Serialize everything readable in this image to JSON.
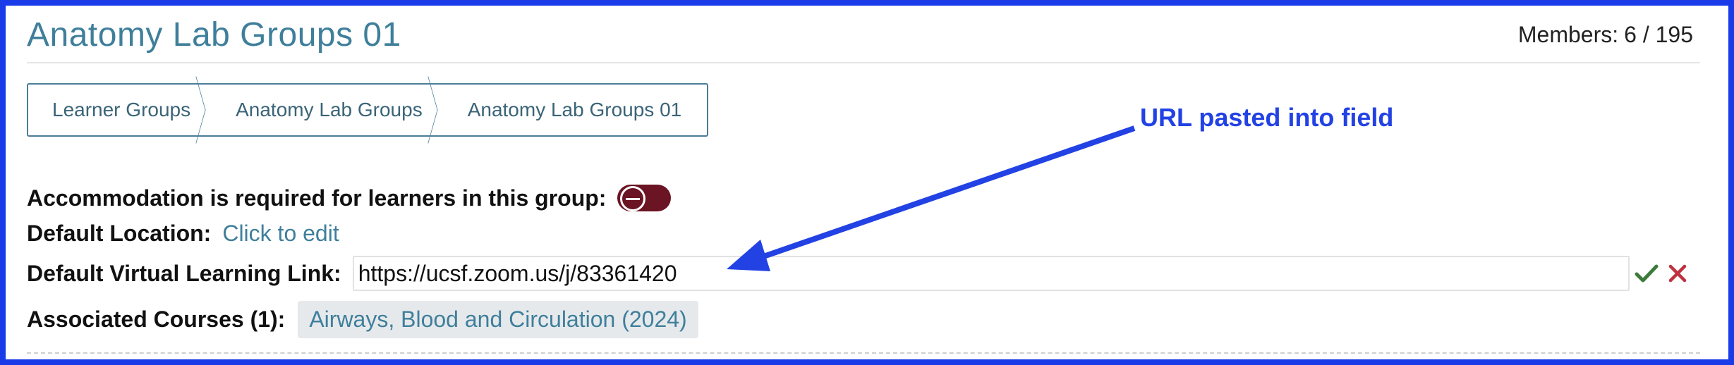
{
  "header": {
    "title": "Anatomy Lab Groups 01",
    "members_label": "Members:",
    "members_value": "6 / 195"
  },
  "breadcrumb": {
    "items": [
      "Learner Groups",
      "Anatomy Lab Groups",
      "Anatomy Lab Groups 01"
    ]
  },
  "accommodation": {
    "label": "Accommodation is required for learners in this group:",
    "toggle_state": "off",
    "toggle_color": "#6b1423"
  },
  "default_location": {
    "label": "Default Location:",
    "value": "Click to edit"
  },
  "virtual_link": {
    "label": "Default Virtual Learning Link:",
    "value": "https://ucsf.zoom.us/j/83361420",
    "save_icon": "checkmark-icon",
    "cancel_icon": "x-icon"
  },
  "courses": {
    "label": "Associated Courses (1):",
    "items": [
      "Airways, Blood and Circulation (2024)"
    ]
  },
  "annotation": {
    "text": "URL pasted into field",
    "color": "#2342e4"
  },
  "colors": {
    "accent": "#3f7f9b",
    "frame": "#1a3be8",
    "success": "#3c7a3a",
    "danger": "#c0313e"
  }
}
